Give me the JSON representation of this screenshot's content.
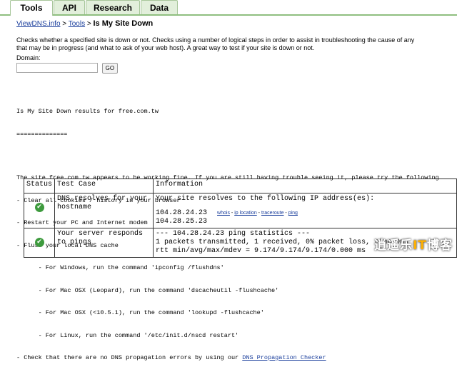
{
  "tabs": [
    {
      "label": "Tools",
      "active": true
    },
    {
      "label": "API",
      "active": false
    },
    {
      "label": "Research",
      "active": false
    },
    {
      "label": "Data",
      "active": false
    }
  ],
  "breadcrumb": {
    "home": "ViewDNS.info",
    "sep1": " > ",
    "tools": "Tools",
    "sep2": " > ",
    "current": "Is My Site Down"
  },
  "description_lines": [
    "Checks whether a specified site is down or not. Checks using a number of logical steps in order to assist in troubleshooting the cause of any",
    "that may be in progress (and what to ask of your web host). A great way to test if your site is down or not."
  ],
  "form": {
    "domain_label": "Domain:",
    "domain_value": "",
    "go_label": "GO"
  },
  "results": {
    "heading": "Is My Site Down results for free.com.tw",
    "underline": "==============",
    "summary": "The site free.com.tw appears to be working fine. If you are still having trouble seeing it, please try the following",
    "steps": [
      "- Clear all cookies / history in your browser",
      "- Restart your PC and Internet modem",
      "- Flush your local DNS cache",
      "      - For Windows, run the command 'ipconfig /flushdns'",
      "      - For Mac OSX (Leopard), run the command 'dscacheutil -flushcache'",
      "      - For Mac OSX (<10.5.1), run the command 'lookupd -flushcache'",
      "      - For Linux, run the command '/etc/init.d/nscd restart'"
    ],
    "last_step_prefix": "- Check that there are no DNS propagation errors by using our ",
    "last_step_link": "DNS Propagation Checker"
  },
  "table": {
    "headers": [
      "Status",
      "Test Case",
      "Information"
    ],
    "rows": [
      {
        "status": "ok",
        "test": "DNS resolves for your hostname",
        "info_line": "Your site resolves to the following IP address(es):",
        "ips": [
          "104.28.24.23",
          "104.28.25.23"
        ],
        "ip_tools": [
          "whois",
          "ip location",
          "traceroute",
          "ping"
        ],
        "tool_sep": " - "
      },
      {
        "status": "ok",
        "test": "Your server responds to pings",
        "ping_lines": [
          "--- 104.28.24.23 ping statistics ---",
          "1 packets transmitted, 1 received, 0% packet loss, time 0ms",
          "rtt min/avg/max/mdev = 9.174/9.174/9.174/0.000 ms"
        ]
      }
    ]
  },
  "watermark": {
    "text_a": "逍遥乐",
    "text_it": "IT",
    "text_b": "博客"
  },
  "colors": {
    "link": "#1a3e9c",
    "tab_bg": "#e2efdb",
    "tab_border": "#8fbf7f",
    "ok_green": "#3d9a3d"
  }
}
